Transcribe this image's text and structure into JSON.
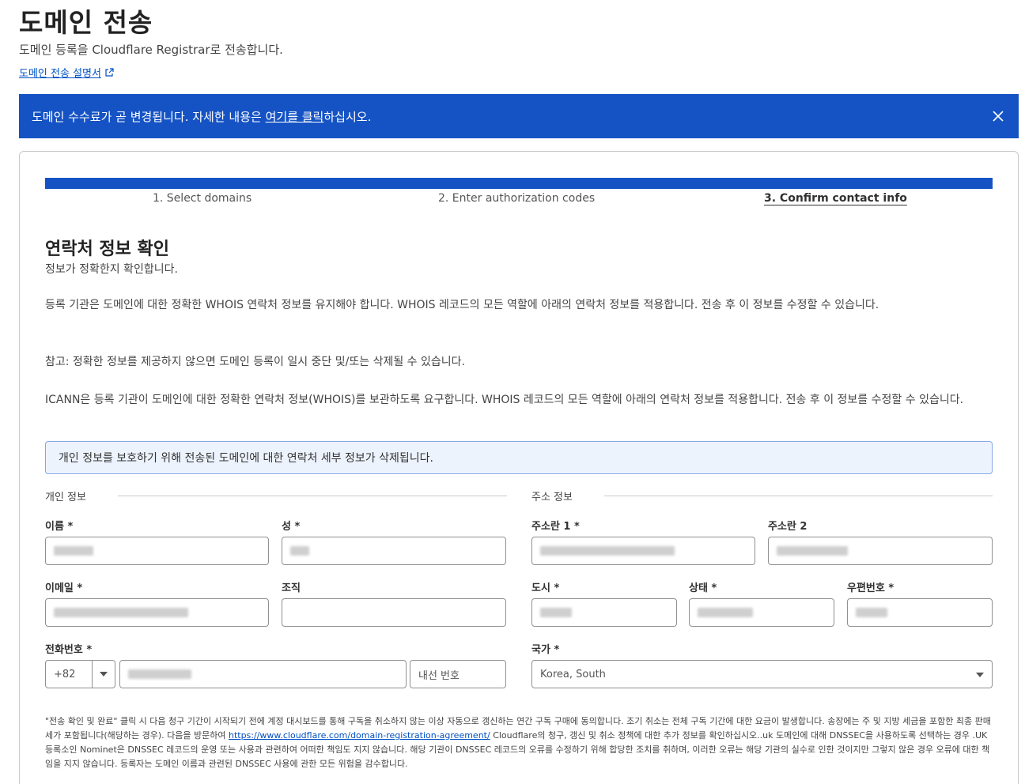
{
  "header": {
    "title": "도메인 전송",
    "subtitle": "도메인 등록을 Cloudflare Registrar로 전송합니다.",
    "doc_link": "도메인 전송 설명서"
  },
  "banner": {
    "text_before": "도메인 수수료가 곧 변경됩니다. 자세한 내용은 ",
    "link": "여기를 클릭",
    "text_after": "하십시오."
  },
  "steps": [
    {
      "label": "1. Select domains",
      "active": false
    },
    {
      "label": "2. Enter authorization codes",
      "active": false
    },
    {
      "label": "3. Confirm contact info",
      "active": true
    }
  ],
  "section": {
    "title": "연락처 정보 확인",
    "subtitle": "정보가 정확한지 확인합니다.",
    "para1": "등록 기관은 도메인에 대한 정확한 WHOIS 연락처 정보를 유지해야 합니다. WHOIS 레코드의 모든 역할에 아래의 연락처 정보를 적용합니다. 전송 후 이 정보를 수정할 수 있습니다.",
    "para2": "참고: 정확한 정보를 제공하지 않으면 도메인 등록이 일시 중단 및/또는 삭제될 수 있습니다.",
    "para3": "ICANN은 등록 기관이 도메인에 대한 정확한 연락처 정보(WHOIS)를 보관하도록 요구합니다. WHOIS 레코드의 모든 역할에 아래의 연락처 정보를 적용합니다. 전송 후 이 정보를 수정할 수 있습니다.",
    "info": "개인 정보를 보호하기 위해 전송된 도메인에 대한 연락처 세부 정보가 삭제됩니다."
  },
  "personal": {
    "group": "개인 정보",
    "first_name": "이름 *",
    "last_name": "성 *",
    "email": "이메일 *",
    "org": "조직",
    "phone": "전화번호 *",
    "country_code": "+82",
    "extension_placeholder": "내선 번호"
  },
  "address": {
    "group": "주소 정보",
    "line1": "주소란 1 *",
    "line2": "주소란 2",
    "city": "도시 *",
    "state": "상태 *",
    "postal": "우편번호 *",
    "country": "국가 *",
    "country_value": "Korea, South"
  },
  "footer": {
    "text_before": "\"전송 확인 및 완료\" 클릭 시 다음 청구 기간이 시작되기 전에 계정 대시보드를 통해 구독을 취소하지 않는 이상 자동으로 갱신하는 연간 구독 구매에 동의합니다. 조기 취소는 전체 구독 기간에 대한 요금이 발생합니다. 송장에는 주 및 지방 세금을 포함한 최종 판매세가 포함됩니다(해당하는 경우). 다음을 방문하여 ",
    "link": "https://www.cloudflare.com/domain-registration-agreement/",
    "text_after": " Cloudflare의 청구, 갱신 및 취소 정책에 대한 추가 정보를 확인하십시오..uk 도메인에 대해 DNSSEC을 사용하도록 선택하는 경우 .UK 등록소인 Nominet은 DNSSEC 레코드의 운영 또는 사용과 관련하여 어떠한 책임도 지지 않습니다. 해당 기관이 DNSSEC 레코드의 오류를 수정하기 위해 합당한 조치를 취하며, 이러한 오류는 해당 기관의 실수로 인한 것이지만 그렇지 않은 경우 오류에 대한 책임을 지지 않습니다. 등록자는 도메인 이름과 관련된 DNSSEC 사용에 관한 모든 위험을 감수합니다."
  },
  "colors": {
    "accent": "#1553c4",
    "link": "#0051c3",
    "info_bg": "#edf3fd"
  }
}
